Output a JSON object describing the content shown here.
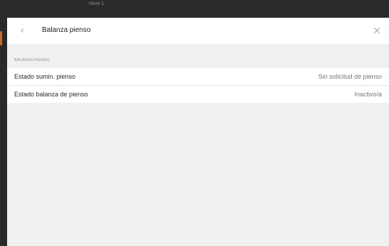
{
  "background": {
    "header_text": "Nivel 1"
  },
  "dialog": {
    "title": "Balanza pienso",
    "back_icon": "chevron-left-icon",
    "close_icon": "close-icon",
    "section_label": "BALANZA PIENSO",
    "rows": [
      {
        "label": "Estado sumin. pienso",
        "value": "Sin solicitud de pienso"
      },
      {
        "label": "Estado balanza de pienso",
        "value": "Inactivo/a"
      }
    ]
  },
  "colors": {
    "app_dark": "#2a2a2a",
    "accent": "#c76a2a",
    "dialog_bg": "#f0f0f0"
  }
}
